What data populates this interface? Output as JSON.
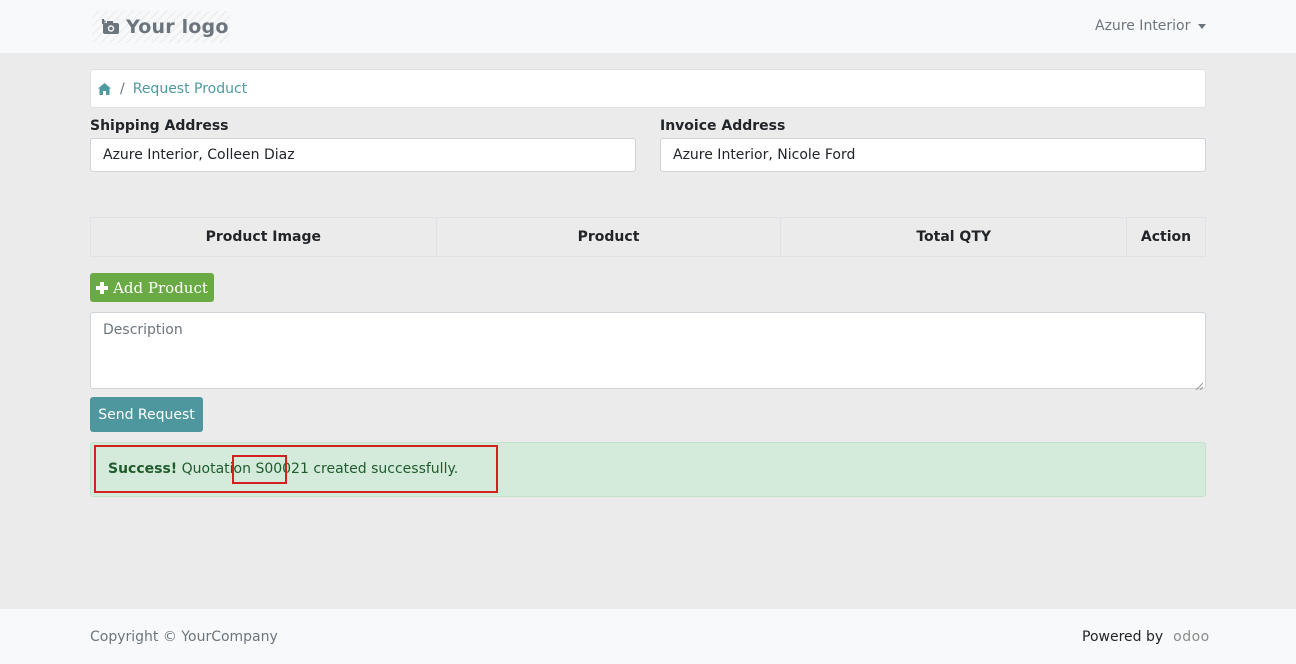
{
  "header": {
    "logo_text": "Your logo",
    "user_name": "Azure Interior"
  },
  "breadcrumb": {
    "separator": "/",
    "current": "Request Product"
  },
  "form": {
    "shipping_label": "Shipping Address",
    "shipping_value": "Azure Interior, Colleen Diaz",
    "invoice_label": "Invoice Address",
    "invoice_value": "Azure Interior, Nicole Ford"
  },
  "table": {
    "columns": [
      "Product Image",
      "Product",
      "Total QTY",
      "Action"
    ]
  },
  "buttons": {
    "add_product": "Add Product",
    "send_request": "Send Request"
  },
  "description": {
    "placeholder": "Description"
  },
  "alert": {
    "strong": "Success!",
    "prefix": " Quotation ",
    "quotation_number": "S00021",
    "suffix": " created successfully."
  },
  "footer": {
    "copyright": "Copyright © YourCompany",
    "powered_by": "Powered by",
    "odoo_brand": "odoo"
  },
  "colors": {
    "accent": "#4e979e",
    "add_button": "#6aaa45",
    "alert_bg": "#d4eadb",
    "highlight": "#d42020"
  }
}
